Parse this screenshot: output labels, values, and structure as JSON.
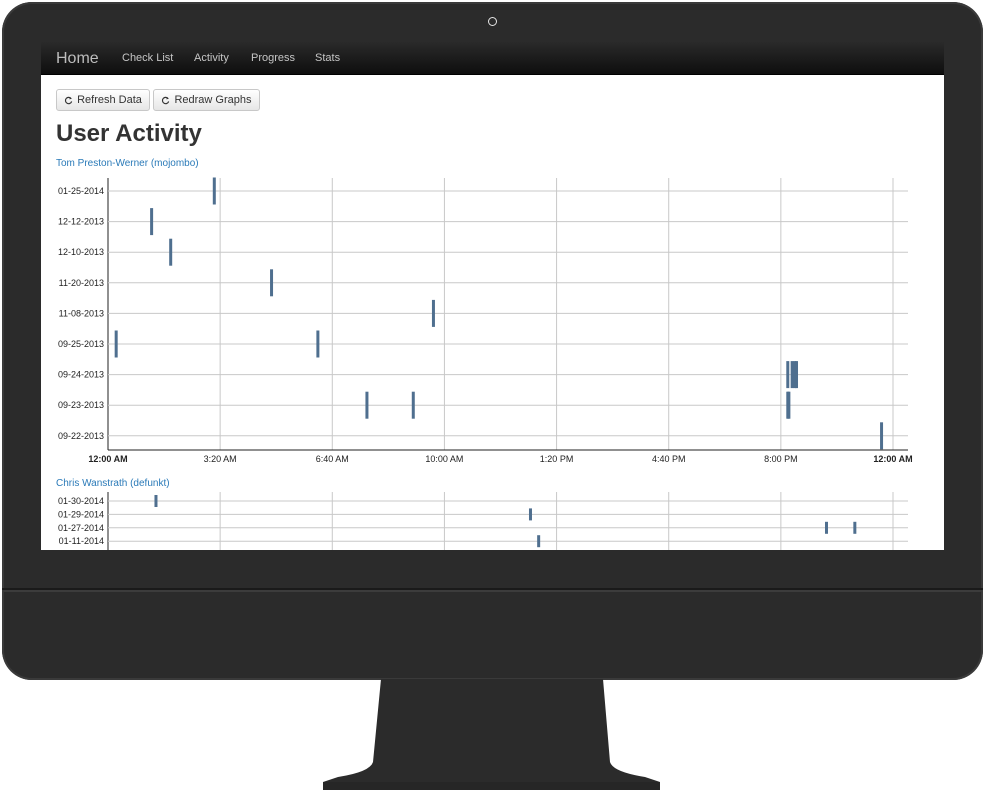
{
  "navbar": {
    "brand": "Home",
    "items": [
      "Check List",
      "Activity",
      "Progress",
      "Stats"
    ]
  },
  "toolbar": {
    "refresh_label": "Refresh Data",
    "redraw_label": "Redraw Graphs"
  },
  "page_title": "User Activity",
  "colors": {
    "bar": "#4f6f8f",
    "link": "#2a7ab8",
    "navbar": "#1b1b1b"
  },
  "icons": {
    "refresh": "refresh-icon"
  },
  "users": [
    {
      "name": "Tom Preston-Werner (mojombo)"
    },
    {
      "name": "Chris Wanstrath (defunkt)"
    }
  ],
  "chart_data": [
    {
      "type": "scatter",
      "title": "",
      "xlabel": "",
      "ylabel": "",
      "y_categories": [
        "01-25-2014",
        "12-12-2013",
        "12-10-2013",
        "11-20-2013",
        "11-08-2013",
        "09-25-2013",
        "09-24-2013",
        "09-23-2013",
        "09-22-2013"
      ],
      "x_ticks": [
        "12:00 AM",
        "3:20 AM",
        "6:40 AM",
        "10:00 AM",
        "1:20 PM",
        "4:40 PM",
        "8:00 PM",
        "12:00 AM"
      ],
      "x_range_minutes": [
        0,
        1440
      ],
      "grid": true,
      "points": [
        {
          "date": "01-25-2014",
          "minute": 195
        },
        {
          "date": "12-12-2013",
          "minute": 80
        },
        {
          "date": "12-10-2013",
          "minute": 115
        },
        {
          "date": "11-20-2013",
          "minute": 300
        },
        {
          "date": "11-08-2013",
          "minute": 597
        },
        {
          "date": "09-25-2013",
          "minute": 15
        },
        {
          "date": "09-25-2013",
          "minute": 385
        },
        {
          "date": "09-24-2013",
          "minute": 1247
        },
        {
          "date": "09-24-2013",
          "minute": 1255
        },
        {
          "date": "09-24-2013",
          "minute": 1260
        },
        {
          "date": "09-24-2013",
          "minute": 1263
        },
        {
          "date": "09-23-2013",
          "minute": 475
        },
        {
          "date": "09-23-2013",
          "minute": 560
        },
        {
          "date": "09-23-2013",
          "minute": 1247
        },
        {
          "date": "09-23-2013",
          "minute": 1249
        },
        {
          "date": "09-22-2013",
          "minute": 1419
        }
      ]
    },
    {
      "type": "scatter",
      "title": "",
      "xlabel": "",
      "ylabel": "",
      "y_categories": [
        "01-30-2014",
        "01-29-2014",
        "01-27-2014",
        "01-11-2014"
      ],
      "x_range_minutes": [
        0,
        1440
      ],
      "grid": true,
      "points": [
        {
          "date": "01-30-2014",
          "minute": 88
        },
        {
          "date": "01-29-2014",
          "minute": 775
        },
        {
          "date": "01-27-2014",
          "minute": 1318
        },
        {
          "date": "01-27-2014",
          "minute": 1370
        },
        {
          "date": "01-11-2014",
          "minute": 790
        }
      ]
    }
  ]
}
